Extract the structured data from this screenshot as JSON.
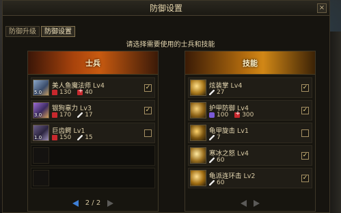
{
  "window": {
    "title": "防御设置",
    "close_label": "×"
  },
  "tabs": [
    {
      "label": "防御升级",
      "active": false
    },
    {
      "label": "防御设置",
      "active": true
    }
  ],
  "hint": "请选择需要使用的士兵和技能",
  "soldiers": {
    "header": "士兵",
    "items": [
      {
        "name": "美人鱼魔法师",
        "level": "Lv4",
        "icon": "mermaid-mage-icon",
        "icon_lv": "5.0",
        "hp": "130",
        "second_stat_icon": "heal-icon",
        "second_stat": "40",
        "checked": true
      },
      {
        "name": "银狗辜力",
        "level": "Lv3",
        "icon": "silver-dog-icon",
        "icon_lv": "3.0",
        "hp": "170",
        "second_stat_icon": "attack-icon",
        "second_stat": "17",
        "checked": true
      },
      {
        "name": "巨齿鳄",
        "level": "Lv1",
        "icon": "crocodile-icon",
        "icon_lv": "1.0",
        "hp": "150",
        "second_stat_icon": "attack-icon",
        "second_stat": "15",
        "checked": false
      }
    ],
    "page": "2 / 2"
  },
  "skills": {
    "header": "技能",
    "items": [
      {
        "name": "炫装掌",
        "level": "Lv4",
        "icon": "palm-strike-icon",
        "stats": [
          {
            "icon": "attack-icon",
            "value": "27"
          }
        ],
        "checked": true
      },
      {
        "name": "护甲防御",
        "level": "Lv4",
        "icon": "armor-defense-icon",
        "stats": [
          {
            "icon": "defense-icon",
            "value": "100"
          },
          {
            "icon": "heal-icon",
            "value": "300"
          }
        ],
        "checked": true
      },
      {
        "name": "龟甲旋击",
        "level": "Lv1",
        "icon": "turtle-spin-icon",
        "stats": [
          {
            "icon": "attack-icon",
            "value": "7"
          }
        ],
        "checked": false
      },
      {
        "name": "寒冰之怒",
        "level": "Lv4",
        "icon": "ice-fury-icon",
        "stats": [
          {
            "icon": "attack-icon",
            "value": "60"
          }
        ],
        "checked": true
      },
      {
        "name": "龟派连环击",
        "level": "Lv2",
        "icon": "turtle-combo-icon",
        "stats": [
          {
            "icon": "attack-icon",
            "value": "60"
          }
        ],
        "checked": true
      }
    ]
  },
  "colors": {
    "soldier_header": "#c85a10",
    "skill_header": "#d18716",
    "active_arrow": "#3e7fd6"
  }
}
